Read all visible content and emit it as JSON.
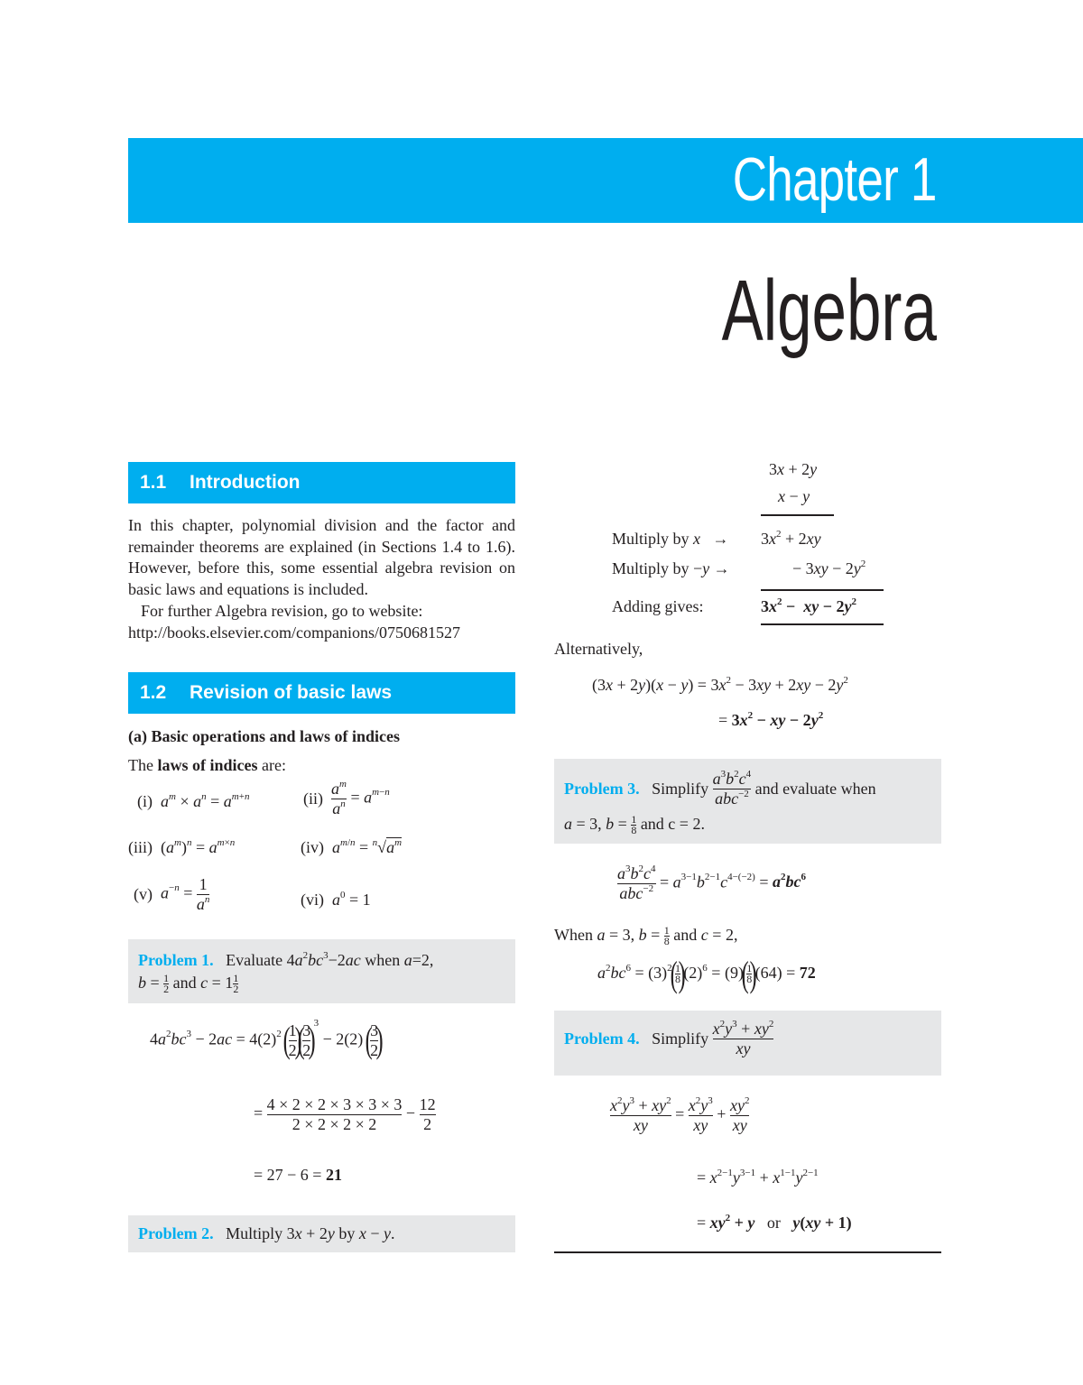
{
  "chapter": {
    "label": "Chapter 1",
    "title": "Algebra",
    "accent_color": "#00aeef",
    "box_color": "#e6e7e8"
  },
  "section_1_1": {
    "number": "1.1",
    "title": "Introduction",
    "paragraph": "In this chapter, polynomial division and the factor and remainder theorems are explained (in Sections 1.4 to 1.6). However, before this, some essential algebra revision on basic laws and equations is included.",
    "further": "For further Algebra revision, go to website:",
    "url": "http://books.elsevier.com/companions/0750681527"
  },
  "section_1_2": {
    "number": "1.2",
    "title": "Revision of basic laws",
    "subheading": "(a) Basic operations and laws of indices",
    "intro_pre": "The ",
    "intro_bold": "laws of indices",
    "intro_post": " are:",
    "laws": [
      {
        "label": "(i)",
        "expr": "a^m × a^n = a^(m+n)"
      },
      {
        "label": "(ii)",
        "expr": "a^m / a^n = a^(m−n)"
      },
      {
        "label": "(iii)",
        "expr": "(a^m)^n = a^(m×n)"
      },
      {
        "label": "(iv)",
        "expr": "a^(m/n) = ⁿ√(a^m)"
      },
      {
        "label": "(v)",
        "expr": "a^(−n) = 1 / a^n"
      },
      {
        "label": "(vi)",
        "expr": "a^0 = 1"
      }
    ]
  },
  "problem1": {
    "label": "Problem 1.",
    "text": "Evaluate 4a²bc³−2ac when a=2, b=½ and c=1½",
    "solution": [
      "4a²bc³ − 2ac = 4(2)²(1/2)(3/2)³ − 2(2)(3/2)",
      "= (4×2×2×3×3×3)/(2×2×2×2) − 12/2",
      "= 27 − 6 = 21"
    ],
    "answer": "21"
  },
  "problem2": {
    "label": "Problem 2.",
    "text": "Multiply 3x + 2y by x − y.",
    "multiplicand": "3x + 2y",
    "multiplier": "x − y",
    "steps": [
      {
        "label": "Multiply by x  →",
        "result": "3x² + 2xy"
      },
      {
        "label": "Multiply by −y →",
        "result": "− 3xy − 2y²"
      },
      {
        "label": "Adding gives:",
        "result": "3x² − xy − 2y²"
      }
    ],
    "alternatively": "Alternatively,",
    "alt_lines": [
      "(3x + 2y)(x − y) = 3x² − 3xy + 2xy − 2y²",
      "= 3x² − xy − 2y²"
    ]
  },
  "problem3": {
    "label": "Problem 3.",
    "text": "Simplify a³b²c⁴/(abc⁻²) and evaluate when a = 3, b = 1/8 and c = 2.",
    "simplify_word": "Simplify",
    "evaluate_text": "and evaluate when",
    "values_text": "and c = 2.",
    "solution": [
      "a³b²c⁴/(abc⁻²) = a^(3−1) b^(2−1) c^(4−(−2)) = a²bc⁶",
      "When a = 3, b = 1/8 and c = 2,",
      "a²bc⁶ = (3)²(1/8)(2)⁶ = (9)(1/8)(64) = 72"
    ],
    "when_word": "When",
    "and_word": "and",
    "answer": "72"
  },
  "problem4": {
    "label": "Problem 4.",
    "text": "Simplify (x²y³ + xy²)/(xy)",
    "simplify_word": "Simplify",
    "solution": [
      "(x²y³ + xy²)/(xy) = x²y³/(xy) + xy²/(xy)",
      "= x^(2−1) y^(3−1) + x^(1−1) y^(2−1)",
      "= xy² + y  or  y(xy + 1)"
    ],
    "or_word": "or"
  }
}
